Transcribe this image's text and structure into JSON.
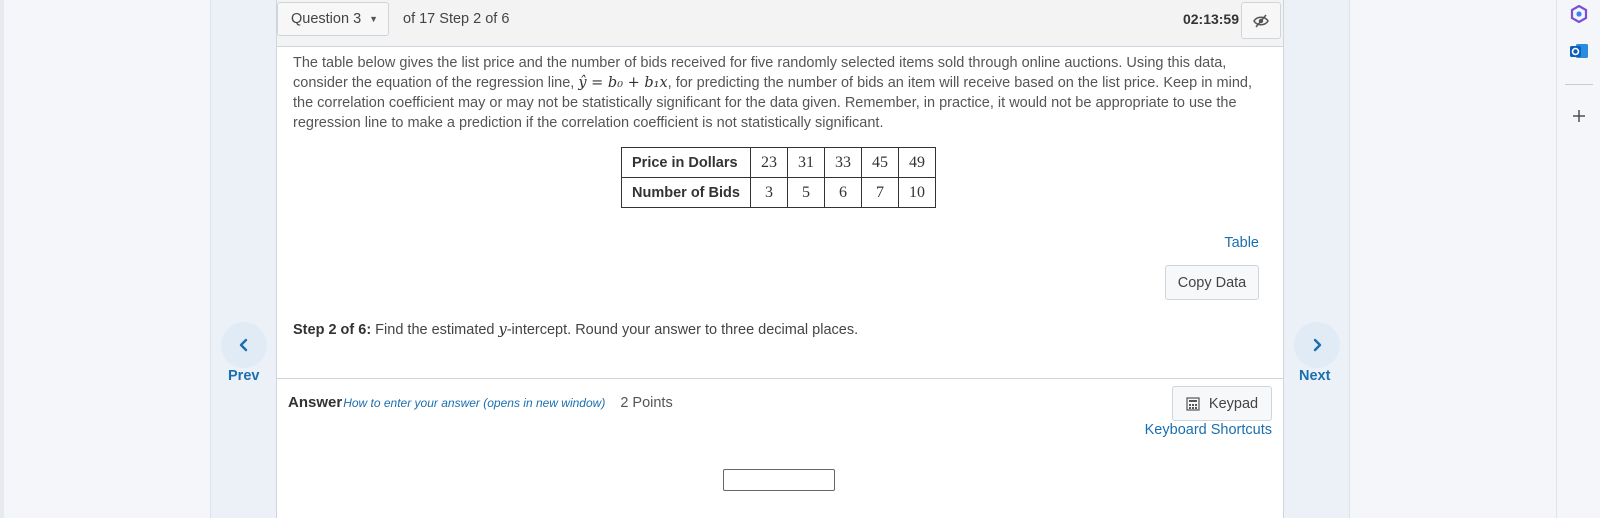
{
  "topbar": {
    "question_selector": "Question 3",
    "of_step": "of 17 Step 2 of 6",
    "timer": "02:13:59"
  },
  "question": {
    "text_before": "The table below gives the list price and the number of bids received for five randomly selected items sold through online auctions. Using this data, consider the equation of the regression line, ",
    "equation": "ŷ = b₀ + b₁x",
    "text_after": ", for predicting the number of bids an item will receive based on the list price. Keep in mind, the correlation coefficient may or may not be statistically significant for the data given. Remember, in practice, it would not be appropriate to use the regression line to make a prediction if the correlation coefficient is not statistically significant."
  },
  "table": {
    "row1_header": "Price in Dollars",
    "row1": [
      "23",
      "31",
      "33",
      "45",
      "49"
    ],
    "row2_header": "Number of Bids",
    "row2": [
      "3",
      "5",
      "6",
      "7",
      "10"
    ]
  },
  "actions": {
    "table_link": "Table",
    "copy_data": "Copy Data"
  },
  "step": {
    "label": "Step 2 of 6:",
    "text_before": " Find the estimated ",
    "variable": "y",
    "text_after": "-intercept. Round your answer to three decimal places."
  },
  "answer": {
    "label": "Answer",
    "help_link": "How to enter your answer (opens in new window)",
    "points": "2 Points",
    "keypad": "Keypad",
    "shortcuts": "Keyboard Shortcuts",
    "input_value": ""
  },
  "nav": {
    "prev": "Prev",
    "next": "Next"
  },
  "colors": {
    "link": "#1a6fb0",
    "nav_circle": "#e1ebf6"
  }
}
